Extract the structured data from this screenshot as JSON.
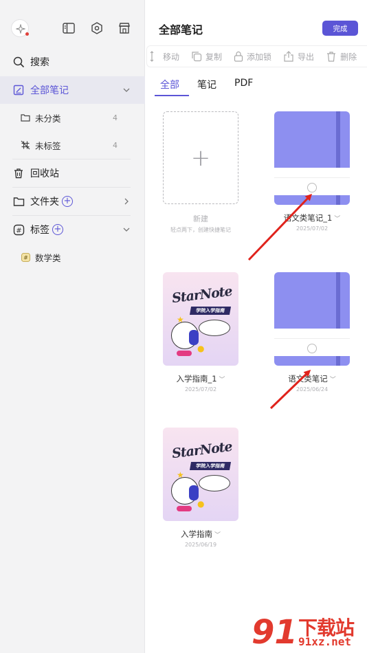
{
  "sidebar": {
    "search": "搜索",
    "all_notes": "全部笔记",
    "uncategorized": "未分类",
    "uncategorized_count": "4",
    "untagged": "未标签",
    "untagged_count": "4",
    "recycle": "回收站",
    "folders": "文件夹",
    "tags": "标签",
    "tag_items": [
      "数学类"
    ]
  },
  "header": {
    "title": "全部笔记",
    "done": "完成"
  },
  "toolbar": {
    "move": "移动",
    "copy": "复制",
    "lock": "添加锁",
    "export": "导出",
    "delete": "删除"
  },
  "tabs": [
    "全部",
    "笔记",
    "PDF"
  ],
  "active_tab": "全部",
  "new_card": {
    "label": "新建",
    "hint": "轻点两下，创建快捷笔记"
  },
  "notes": [
    {
      "name": "语文类笔记_1",
      "date": "2025/07/02",
      "cover": "notebook-purple"
    },
    {
      "name": "入学指南_1",
      "date": "2025/07/02",
      "cover": "starnote-guide"
    },
    {
      "name": "语文类笔记",
      "date": "2025/06/24",
      "cover": "notebook-purple"
    },
    {
      "name": "入学指南",
      "date": "2025/06/19",
      "cover": "starnote-guide"
    }
  ],
  "cover_art": {
    "logo": "StarNote",
    "banner": "学院入学指南"
  },
  "watermark": {
    "logo": "91",
    "text": "下载站",
    "url": "91xz.net"
  },
  "colors": {
    "accent": "#5b55d6",
    "notebook": "#8d8ff0",
    "annotation_arrow": "#e0231c"
  }
}
